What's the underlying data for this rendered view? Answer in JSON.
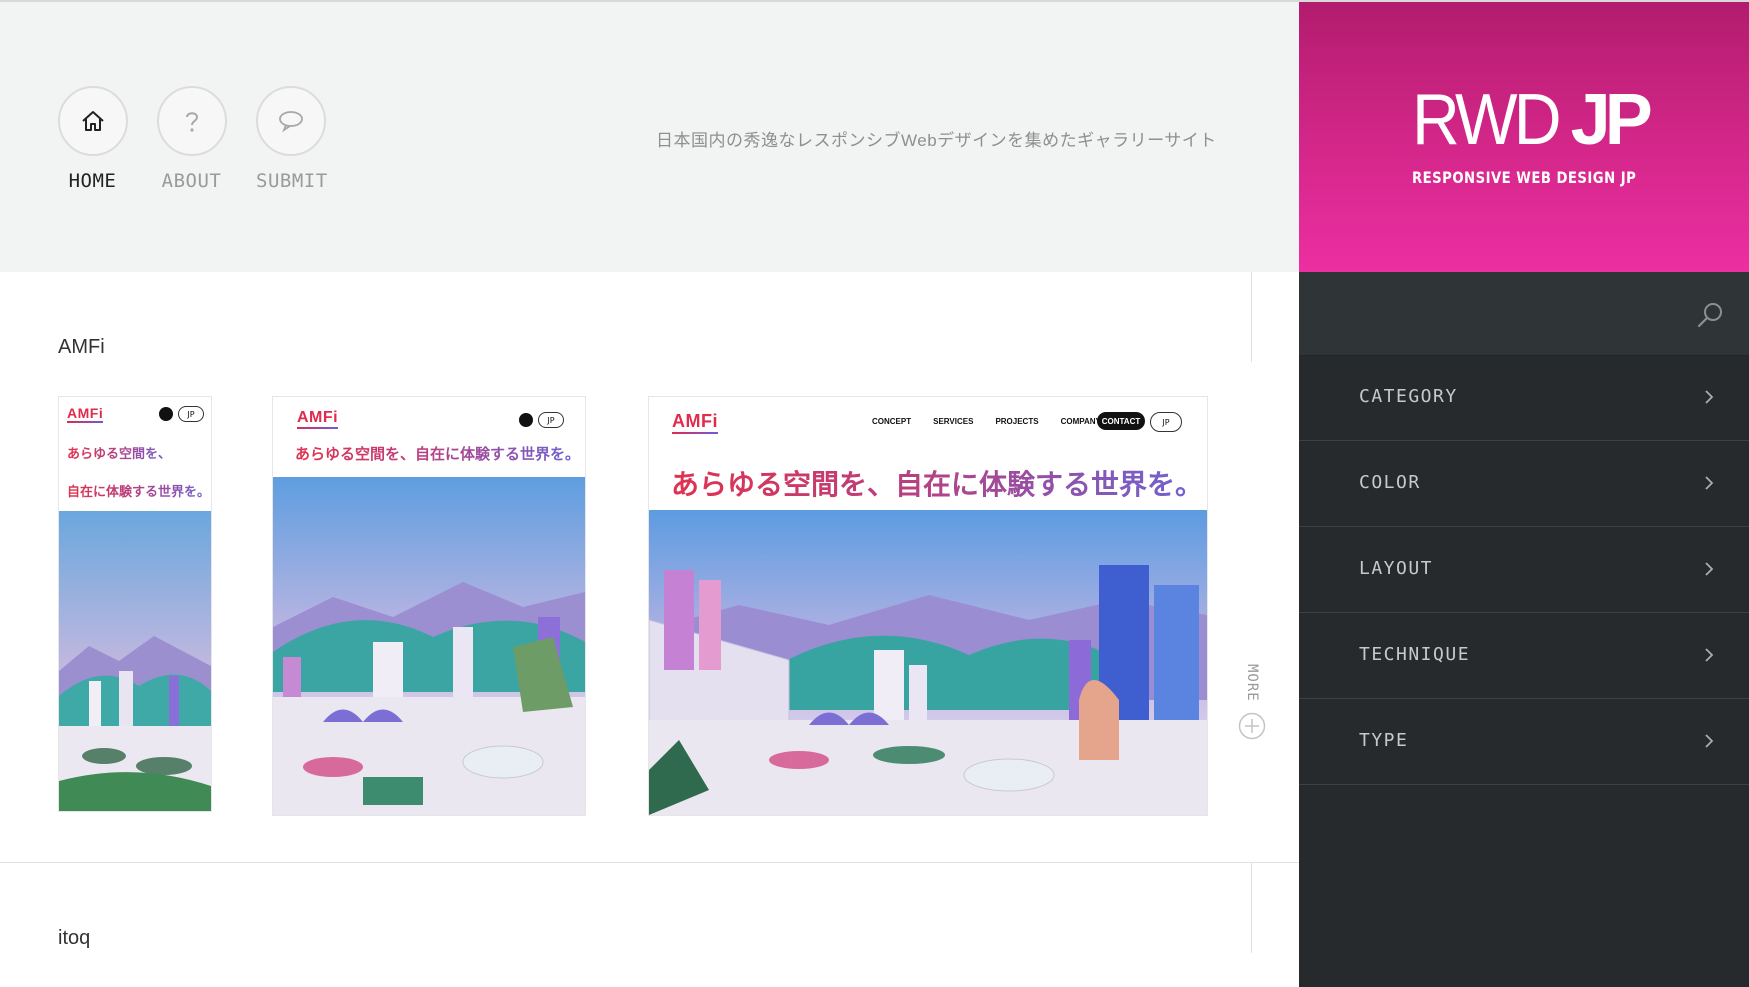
{
  "nav": {
    "items": [
      {
        "label": "HOME",
        "icon": "home-icon"
      },
      {
        "label": "ABOUT",
        "icon": "question-icon"
      },
      {
        "label": "SUBMIT",
        "icon": "speech-bubble-icon"
      }
    ]
  },
  "header": {
    "tagline": "日本国内の秀逸なレスポンシブWebデザインを集めたギャラリーサイト"
  },
  "sections": [
    {
      "title": "AMFi",
      "more_label": "MORE",
      "preview": {
        "logo": "AMFi",
        "headline": "あらゆる空間を、自在に体験する世界を。",
        "headline_line1": "あらゆる空間を、",
        "headline_line2": "自在に体験する世界を。",
        "lang": "JP",
        "menu": [
          "CONCEPT",
          "SERVICES",
          "PROJECTS",
          "COMPANY"
        ],
        "contact": "CONTACT"
      }
    },
    {
      "title": "itoq"
    }
  ],
  "sidebar": {
    "logo_main": "RWD",
    "logo_accent": "JP",
    "logo_sub": "RESPONSIVE WEB DESIGN JP",
    "menu": [
      "CATEGORY",
      "COLOR",
      "LAYOUT",
      "TECHNIQUE",
      "TYPE"
    ]
  },
  "colors": {
    "brand_pink": "#d22688",
    "sidebar_bg": "#262a2c",
    "header_bg": "#f2f3f3",
    "headline_red": "#e0324f",
    "headline_purple": "#6a64d6"
  }
}
